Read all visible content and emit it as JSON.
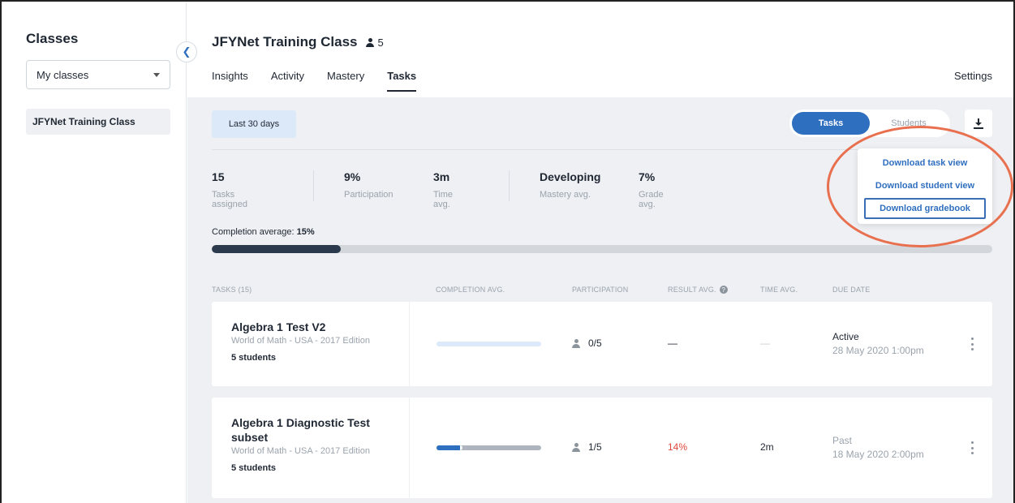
{
  "sidebar": {
    "title": "Classes",
    "class_filter": "My classes",
    "classes": [
      "JFYNet Training Class"
    ]
  },
  "header": {
    "class_name": "JFYNet Training Class",
    "student_count": "5",
    "tabs": [
      "Insights",
      "Activity",
      "Mastery",
      "Tasks"
    ],
    "active_tab": "Tasks",
    "settings_label": "Settings"
  },
  "toolbar": {
    "date_range": "Last 30 days",
    "view_toggle": [
      "Tasks",
      "Students"
    ],
    "active_view": "Tasks",
    "download_icon": "download-icon"
  },
  "download_menu": {
    "items": [
      "Download task view",
      "Download student view",
      "Download gradebook"
    ],
    "focused": "Download gradebook",
    "highlight_color": "#e8704f"
  },
  "stats": [
    {
      "value": "15",
      "label": "Tasks assigned"
    },
    {
      "value": "9%",
      "label": "Participation"
    },
    {
      "value": "3m",
      "label": "Time avg."
    },
    {
      "value": "Developing",
      "label": "Mastery avg."
    },
    {
      "value": "7%",
      "label": "Grade avg."
    }
  ],
  "completion": {
    "label": "Completion average:",
    "value": "15%",
    "fraction": 0.165
  },
  "table": {
    "headers": [
      "TASKS (15)",
      "COMPLETION AVG.",
      "PARTICIPATION",
      "RESULT AVG.",
      "TIME AVG.",
      "DUE DATE"
    ],
    "rows": [
      {
        "title": "Algebra 1 Test V2",
        "source": "World of Math - USA - 2017 Edition",
        "students": "5 students",
        "completion_fraction": 0,
        "participation": "0/5",
        "result": "—",
        "time": "—",
        "status": "Active",
        "due": "28 May 2020 1:00pm"
      },
      {
        "title": "Algebra 1 Diagnostic Test subset",
        "source": "World of Math - USA - 2017 Edition",
        "students": "5 students",
        "completion_fraction": 0.25,
        "participation": "1/5",
        "result": "14%",
        "time": "2m",
        "status": "Past",
        "due": "18 May 2020 2:00pm"
      }
    ]
  },
  "colors": {
    "accent": "#2f6fbf",
    "result_low": "#e0483a",
    "completion_bar": "#2c3a4d"
  }
}
